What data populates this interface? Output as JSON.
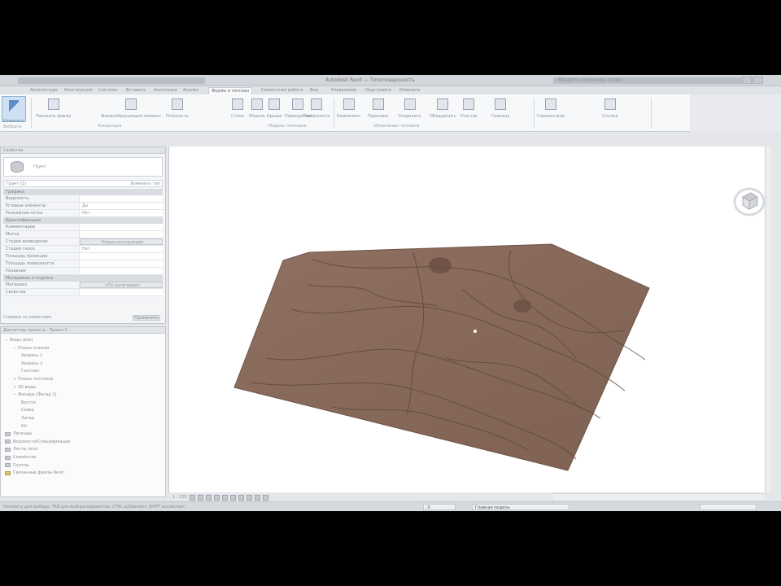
{
  "window": {
    "title": "Autodesk Revit — Топоповерхность",
    "search_placeholder": "Введите ключевое слово"
  },
  "ribbon": {
    "tabs": [
      {
        "label": "Архитектура"
      },
      {
        "label": "Конструкция"
      },
      {
        "label": "Системы"
      },
      {
        "label": "Вставить"
      },
      {
        "label": "Аннотации"
      },
      {
        "label": "Анализ"
      },
      {
        "label": "Формы и генплан",
        "active": true
      },
      {
        "label": "Совместная работа"
      },
      {
        "label": "Вид"
      },
      {
        "label": "Управление"
      },
      {
        "label": "Надстройки"
      },
      {
        "label": "Изменить"
      }
    ],
    "modify_label": "Изменить",
    "select_label": "Выбрать",
    "buttons": [
      {
        "label": "Показать форму"
      },
      {
        "label": "Формообразующий элемент"
      },
      {
        "label": "Плоскость"
      },
      {
        "label": "Стена"
      },
      {
        "label": "Модель"
      },
      {
        "label": "Крыша"
      },
      {
        "label": "Перекрытие"
      },
      {
        "label": "Поверхность"
      },
      {
        "label": "Компонент"
      },
      {
        "label": "Парковка"
      },
      {
        "label": "Разделить"
      },
      {
        "label": "Объединить"
      },
      {
        "label": "Участок"
      },
      {
        "label": "Граница"
      },
      {
        "label": "Горизонтали"
      },
      {
        "label": "Ссылка"
      }
    ],
    "groups": [
      {
        "label": "Концепция"
      },
      {
        "label": "Модель генплана"
      },
      {
        "label": "Изменение генплана"
      }
    ]
  },
  "properties": {
    "header": "Свойства",
    "type_name": "Грунт",
    "filter": "Грунт (1)",
    "edit_type": "Изменить тип",
    "sections": [
      {
        "title": "Графика",
        "rows": [
          {
            "name": "Видимость",
            "value": ""
          },
          {
            "name": "Угловые элементы",
            "value": "Да"
          },
          {
            "name": "Рельефная сетка",
            "value": "Нет"
          }
        ]
      },
      {
        "title": "Идентификация",
        "rows": [
          {
            "name": "Комментарии",
            "value": ""
          },
          {
            "name": "Метка",
            "value": ""
          },
          {
            "name": "Стадия возведения",
            "value": "Новая конструкция"
          },
          {
            "name": "Стадия сноса",
            "value": "Нет"
          },
          {
            "name": "Площадь проекции",
            "value": ""
          },
          {
            "name": "Площадь поверхности",
            "value": ""
          },
          {
            "name": "Название",
            "value": ""
          }
        ]
      },
      {
        "title": "Материалы и отделка",
        "rows": [
          {
            "name": "Материал",
            "value": "<По категории>"
          },
          {
            "name": "Свойства",
            "value": ""
          }
        ]
      }
    ],
    "help_link": "Справка по свойствам",
    "apply": "Применить"
  },
  "browser": {
    "header": "Диспетчер проекта - Проект1",
    "items": [
      {
        "label": "Виды (все)",
        "level": 0,
        "toggle": "−"
      },
      {
        "label": "Планы этажей",
        "level": 1,
        "toggle": "−"
      },
      {
        "label": "Уровень 1",
        "level": 2
      },
      {
        "label": "Уровень 2",
        "level": 2
      },
      {
        "label": "Генплан",
        "level": 2
      },
      {
        "label": "Планы потолков",
        "level": 1,
        "toggle": "+"
      },
      {
        "label": "3D виды",
        "level": 1,
        "toggle": "+"
      },
      {
        "label": "Фасады (Фасад 1)",
        "level": 1,
        "toggle": "−"
      },
      {
        "label": "Восток",
        "level": 2
      },
      {
        "label": "Север",
        "level": 2
      },
      {
        "label": "Запад",
        "level": 2
      },
      {
        "label": "Юг",
        "level": 2
      },
      {
        "label": "Легенды",
        "level": 0,
        "icon": "grey"
      },
      {
        "label": "Ведомости/Спецификации",
        "level": 0,
        "icon": "grey"
      },
      {
        "label": "Листы (все)",
        "level": 0,
        "icon": "grey"
      },
      {
        "label": "Семейства",
        "level": 0,
        "icon": "grey"
      },
      {
        "label": "Группы",
        "level": 0,
        "icon": "grey"
      },
      {
        "label": "Связанные файлы Revit",
        "level": 0,
        "icon": "yellow"
      }
    ]
  },
  "viewport": {
    "surface_color": "#8a6b5c",
    "contour_color": "#5e4538"
  },
  "view_controls": {
    "scale": "1 : 100"
  },
  "status": {
    "left_text": "Нажмите для выбора, TAB для выбора вариантов, CTRL добавляет, SHIFT исключает.",
    "model_label": "Главная модель",
    "zero": ":0"
  },
  "colors": {
    "accent": "#5b8fc7",
    "surface": "#8a6b5c"
  }
}
